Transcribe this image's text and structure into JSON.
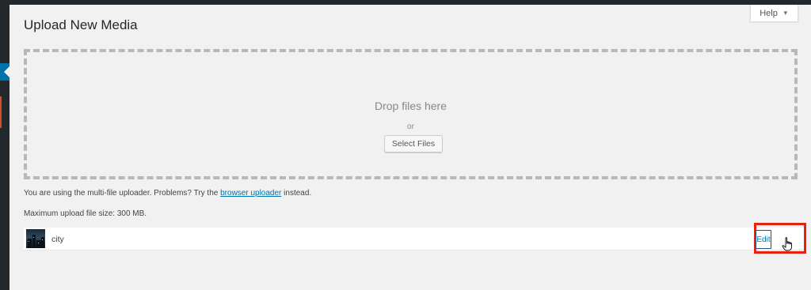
{
  "page": {
    "title": "Upload New Media"
  },
  "help": {
    "label": "Help",
    "caret": "▼"
  },
  "uploader": {
    "drop_text": "Drop files here",
    "or_text": "or",
    "select_button": "Select Files"
  },
  "notes": {
    "multi_prefix": "You are using the multi-file uploader. Problems? Try the",
    "browser_link": "browser uploader",
    "multi_suffix": "instead.",
    "max_size": "Maximum upload file size: 300 MB."
  },
  "media_items": [
    {
      "filename": "city",
      "edit_label": "Edit"
    }
  ],
  "icons": {
    "sidebar_indicator": "arrow-left-icon",
    "help_caret": "caret-down-icon",
    "cursor": "hand-pointer-icon"
  },
  "colors": {
    "sidebar": "#23282d",
    "active_menu": "#0073aa",
    "link": "#0073aa",
    "highlight": "#e8210f"
  }
}
